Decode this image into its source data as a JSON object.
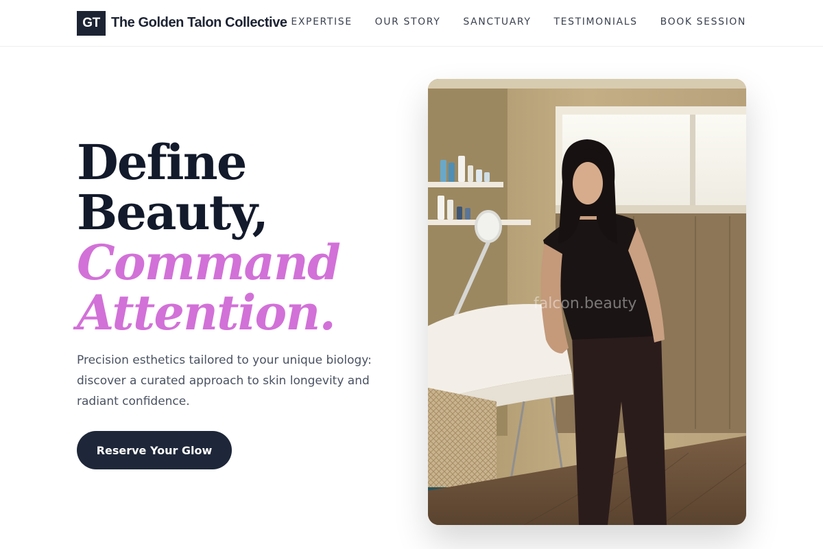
{
  "brand": {
    "initials": "GT",
    "name": "The Golden Talon Collective"
  },
  "nav": {
    "items": [
      {
        "label": "EXPERTISE"
      },
      {
        "label": "OUR STORY"
      },
      {
        "label": "SANCTUARY"
      },
      {
        "label": "TESTIMONIALS"
      },
      {
        "label": "BOOK SESSION"
      }
    ]
  },
  "hero": {
    "headline_line1": "Define",
    "headline_line2": "Beauty,",
    "headline_accent1": "Command",
    "headline_accent2": "Attention.",
    "subtext": "Precision esthetics tailored to your unique biology: discover a curated approach to skin longevity and radiant confidence.",
    "cta_label": "Reserve Your Glow",
    "image_watermark": "falcon.beauty"
  },
  "colors": {
    "primary_dark": "#1e2739",
    "accent_orchid": "#d271d8",
    "body_text": "#4a5262"
  }
}
